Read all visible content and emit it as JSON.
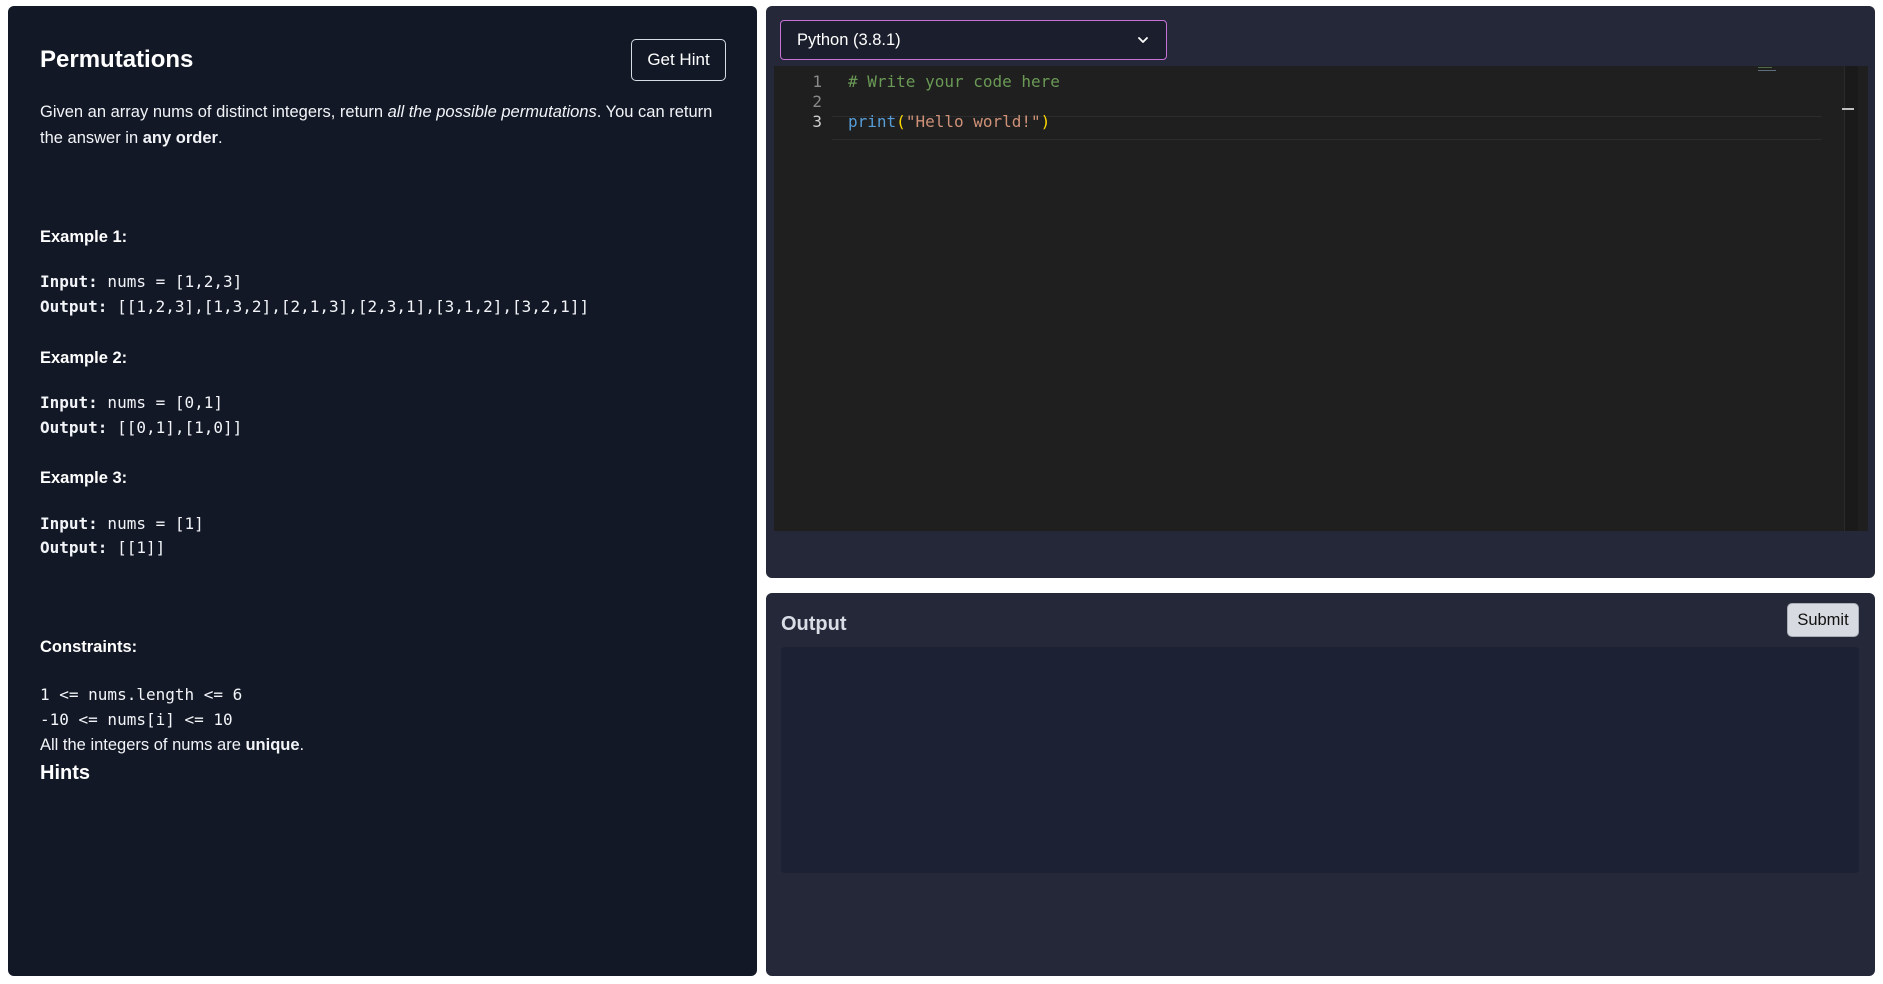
{
  "problem": {
    "title": "Permutations",
    "hint_button": "Get Hint",
    "description": {
      "p1": "Given an array ",
      "code1": "nums",
      "p2": " of distinct integers, return ",
      "em1": "all the possible permutations",
      "p3": ". You can return the answer in ",
      "strong1": "any order",
      "p4": "."
    },
    "examples": [
      {
        "heading": "Example 1:",
        "input_label": "Input:",
        "input": " nums = [1,2,3]",
        "output_label": "Output:",
        "output": " [[1,2,3],[1,3,2],[2,1,3],[2,3,1],[3,1,2],[3,2,1]]"
      },
      {
        "heading": "Example 2:",
        "input_label": "Input:",
        "input": " nums = [0,1]",
        "output_label": "Output:",
        "output": " [[0,1],[1,0]]"
      },
      {
        "heading": "Example 3:",
        "input_label": "Input:",
        "input": " nums = [1]",
        "output_label": "Output:",
        "output": " [[1]]"
      }
    ],
    "constraints": {
      "heading": "Constraints:",
      "c1": "1 <= nums.length <= 6",
      "c2": "-10 <= nums[i] <= 10",
      "c3_pre": "All the integers of ",
      "c3_code": "nums",
      "c3_mid": " are ",
      "c3_strong": "unique",
      "c3_post": "."
    },
    "hints_heading": "Hints"
  },
  "editor": {
    "language": "Python (3.8.1)",
    "lines": [
      {
        "num": "1",
        "comment": "# Write your code here"
      },
      {
        "num": "2"
      },
      {
        "num": "3",
        "fn": "print",
        "open": "(",
        "str": "\"Hello world!\"",
        "close": ")"
      }
    ]
  },
  "output": {
    "title": "Output",
    "submit_label": "Submit"
  },
  "colors": {
    "panel_dark": "#121826",
    "panel_slate": "#252838",
    "select_border": "#c770d6",
    "editor_bg": "#1f1f1f",
    "output_box": "#1c2233"
  }
}
